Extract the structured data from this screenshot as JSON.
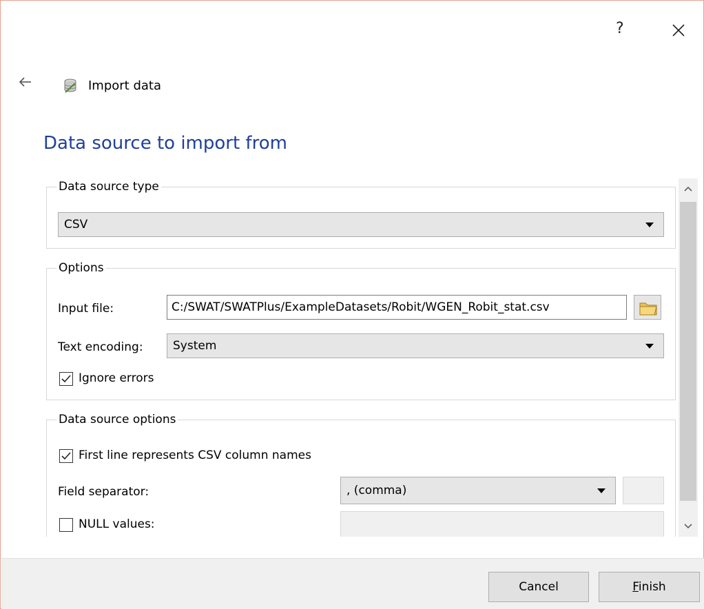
{
  "window": {
    "help_label": "?",
    "close_icon": "close-icon"
  },
  "nav": {
    "back_icon": "back-arrow-icon",
    "app_icon": "database-icon",
    "title": "Import data"
  },
  "page": {
    "heading": "Data source to import from"
  },
  "data_source_type": {
    "legend": "Data source type",
    "selected": "CSV"
  },
  "options": {
    "legend": "Options",
    "input_file_label": "Input file:",
    "input_file_value": "C:/SWAT/SWATPlus/ExampleDatasets/Robit/WGEN_Robit_stat.csv",
    "folder_icon": "folder-icon",
    "text_encoding_label": "Text encoding:",
    "text_encoding_value": "System",
    "ignore_errors_label": "Ignore errors",
    "ignore_errors_checked": true
  },
  "data_source_options": {
    "legend": "Data source options",
    "first_line_label": "First line represents CSV column names",
    "first_line_checked": true,
    "field_separator_label": "Field separator:",
    "field_separator_value": ", (comma)",
    "null_values_label": "NULL values:",
    "null_values_checked": false
  },
  "footer": {
    "cancel_label": "Cancel",
    "finish_first": "F",
    "finish_rest": "inish"
  }
}
